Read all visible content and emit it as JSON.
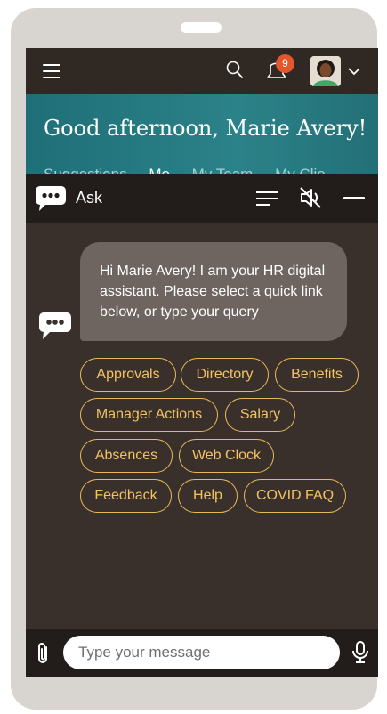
{
  "appbar": {
    "notification_count": "9",
    "icons": [
      "hamburger-menu-icon",
      "search-icon",
      "notification-bell-icon",
      "user-avatar",
      "chevron-down-icon"
    ]
  },
  "banner": {
    "greeting": "Good afternoon, Marie Avery!",
    "tabs": [
      "Suggestions",
      "Me",
      "My Team",
      "My Clie"
    ]
  },
  "chat": {
    "title": "Ask",
    "header_icons": [
      "chat-logo-icon",
      "menu-icon",
      "speaker-muted-icon",
      "minimize-icon"
    ],
    "message": "Hi Marie Avery! I am your HR digital assistant. Please select a quick link below, or type your query",
    "quick_links": [
      "Approvals",
      "Directory",
      "Benefits",
      "Manager Actions",
      "Salary",
      "Absences",
      "Web Clock",
      "Feedback",
      "Help",
      "COVID FAQ"
    ],
    "accent_color": "#f3c363"
  },
  "composer": {
    "placeholder": "Type your message",
    "icons": [
      "paperclip-icon",
      "microphone-icon"
    ]
  }
}
